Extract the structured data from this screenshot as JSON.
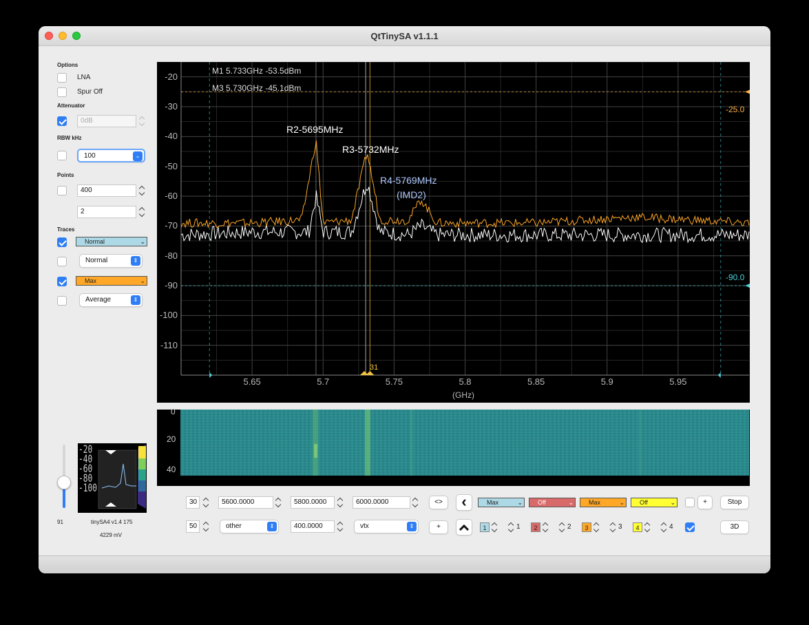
{
  "window": {
    "title": "QtTinySA v1.1.1"
  },
  "options": {
    "section": "Options",
    "lna": "LNA",
    "spur": "Spur Off"
  },
  "attenuator": {
    "section": "Attenuator",
    "value": "0dB"
  },
  "rbw": {
    "section": "RBW kHz",
    "value": "100"
  },
  "points": {
    "section": "Points",
    "value": "400",
    "value2": "2"
  },
  "traces": {
    "section": "Traces",
    "t1": "Normal",
    "t2": "Normal",
    "t3": "Max",
    "t4": "Average"
  },
  "colors": {
    "trace1": "#add8e6",
    "trace2": "#d86a6a",
    "trace3": "#ffa726",
    "trace4": "#ffff33",
    "marker": "#f0c040",
    "limit_hi": "#ffb347",
    "limit_lo": "#4fd1d9"
  },
  "chart": {
    "marker1": "M1 5.733GHz -53.5dBm",
    "marker3": "M3 5.730GHz -45.1dBm",
    "ann_r2": "R2-5695MHz",
    "ann_r3": "R3-5732MHz",
    "ann_r4a": "R4-5769MHz",
    "ann_r4b": "(IMD2)",
    "limit_hi": "-25.0",
    "limit_lo": "-90.0",
    "marker_flag": "31",
    "xunit": "(GHz)",
    "yticks": [
      "-20",
      "-30",
      "-40",
      "-50",
      "-60",
      "-70",
      "-80",
      "-90",
      "-100",
      "-110"
    ],
    "xticks": [
      "5.65",
      "5.7",
      "5.75",
      "5.8",
      "5.85",
      "5.9",
      "5.95"
    ]
  },
  "chart_data": {
    "type": "line",
    "xlabel": "(GHz)",
    "ylabel": "",
    "xlim": [
      5.6,
      6.0
    ],
    "ylim": [
      -120,
      -15
    ],
    "grid": true,
    "series": [
      {
        "name": "Normal",
        "color": "#ffffff",
        "x": [
          5.6,
          5.65,
          5.69,
          5.695,
          5.7,
          5.72,
          5.731,
          5.74,
          5.76,
          5.769,
          5.78,
          5.85,
          5.92,
          6.0
        ],
        "values": [
          -73,
          -72,
          -72,
          -60,
          -72,
          -72,
          -55,
          -72,
          -73,
          -70,
          -73,
          -73,
          -73,
          -73
        ]
      },
      {
        "name": "Max",
        "color": "#ffa726",
        "x": [
          5.6,
          5.65,
          5.685,
          5.695,
          5.7,
          5.72,
          5.731,
          5.74,
          5.76,
          5.769,
          5.78,
          5.85,
          5.92,
          6.0
        ],
        "values": [
          -69,
          -69,
          -68,
          -41,
          -69,
          -68,
          -45,
          -68,
          -68,
          -61,
          -69,
          -69,
          -67,
          -69
        ]
      }
    ]
  },
  "waterfall": {
    "yticks": [
      "0",
      "20",
      "40"
    ]
  },
  "status": {
    "slider": "91",
    "device": "tinySA4 v1.4 175",
    "voltage": "4229 mV",
    "thumb_ticks": [
      "-20",
      "-40",
      "-60",
      "-80",
      "-100"
    ]
  },
  "controls": {
    "row1": {
      "v1": "30",
      "start": "5600.0000",
      "center": "5800.0000",
      "stop": "6000.0000",
      "swap": "<>",
      "t1": "Max",
      "t2": "Off",
      "t3": "Max",
      "t4": "Off",
      "plus": "+",
      "stop_btn": "Stop"
    },
    "row2": {
      "v1": "50",
      "preset": "other",
      "span": "400.0000",
      "band": "vtx",
      "plus": "+",
      "m1": "1",
      "m1b": "1",
      "m2": "2",
      "m2b": "2",
      "m3": "3",
      "m3b": "3",
      "m4": "4",
      "m4b": "4",
      "three_d": "3D"
    }
  }
}
